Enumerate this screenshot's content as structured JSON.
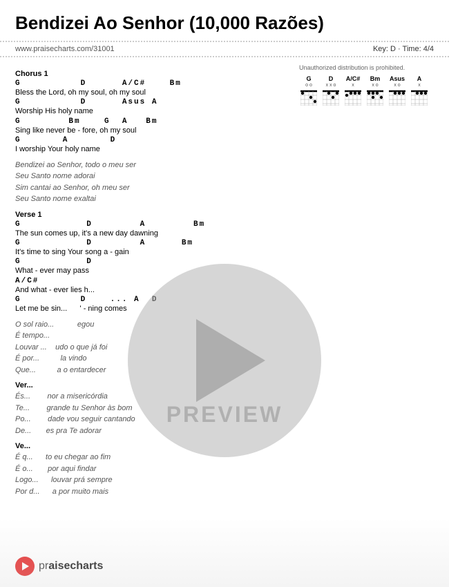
{
  "header": {
    "title": "Bendizei Ao Senhor (10,000 Razões)",
    "url": "www.praisecharts.com/31001",
    "key_time": "Key: D · Time: 4/4"
  },
  "unauthorized": "Unauthorized distribution is prohibited.",
  "chords": [
    {
      "name": "G",
      "indicators": "o o",
      "dots": []
    },
    {
      "name": "D",
      "indicators": "x x o",
      "dots": []
    },
    {
      "name": "A/C#",
      "indicators": "x",
      "dots": []
    },
    {
      "name": "Bm",
      "indicators": "x o",
      "dots": []
    },
    {
      "name": "Asus",
      "indicators": "x o",
      "dots": []
    },
    {
      "name": "A",
      "indicators": "x",
      "dots": []
    }
  ],
  "sections": [
    {
      "label": "Chorus 1",
      "stanzas": [
        {
          "lines": [
            {
              "type": "chord",
              "text": "G          D      A/C#    Bm"
            },
            {
              "type": "lyric",
              "text": "Bless the Lord, oh my soul,  oh  my soul"
            },
            {
              "type": "chord",
              "text": "G          D      Asus  A"
            },
            {
              "type": "lyric",
              "text": "Worship His holy name"
            },
            {
              "type": "chord",
              "text": "G        Bm    G  A   Bm"
            },
            {
              "type": "lyric",
              "text": "Sing like never be - fore, oh my soul"
            },
            {
              "type": "chord",
              "text": "G       A       D"
            },
            {
              "type": "lyric",
              "text": "I worship Your holy name"
            }
          ]
        },
        {
          "lines": [
            {
              "type": "lyric-italic",
              "text": "Bendizei ao Senhor, todo o meu ser"
            },
            {
              "type": "lyric-italic",
              "text": "Seu Santo nome adorai"
            },
            {
              "type": "lyric-italic",
              "text": "Sim cantai ao Senhor, oh meu ser"
            },
            {
              "type": "lyric-italic",
              "text": "Seu Santo nome exaltai"
            }
          ]
        }
      ]
    },
    {
      "label": "Verse 1",
      "stanzas": [
        {
          "lines": [
            {
              "type": "chord",
              "text": "G           D        A         Bm"
            },
            {
              "type": "lyric",
              "text": "The sun comes up, it's a new day dawning"
            },
            {
              "type": "chord",
              "text": "G           D        A      Bm"
            },
            {
              "type": "lyric",
              "text": "It's time to sing Your song a - gain"
            },
            {
              "type": "chord",
              "text": "G           D"
            },
            {
              "type": "lyric",
              "text": "What - ever may pass"
            },
            {
              "type": "chord",
              "text": "A/C#"
            },
            {
              "type": "lyric",
              "text": "And what - ever lies h..."
            },
            {
              "type": "chord",
              "text": "G          D    ... A  D"
            },
            {
              "type": "lyric",
              "text": "Let me be sin...      ' - ning comes"
            }
          ]
        },
        {
          "lines": [
            {
              "type": "lyric-italic",
              "text": "O sol raio...           egou"
            },
            {
              "type": "lyric-italic",
              "text": "É tempo..."
            },
            {
              "type": "lyric-italic",
              "text": "Louvar ...    udo o que já foi"
            },
            {
              "type": "lyric-italic",
              "text": "É por...          la vindo"
            },
            {
              "type": "lyric-italic",
              "text": "Que...          a o entardecer"
            }
          ]
        }
      ]
    },
    {
      "label": "Ver...",
      "stanzas": [
        {
          "lines": [
            {
              "type": "lyric-italic",
              "text": "És...        nor a misericórdia"
            },
            {
              "type": "lyric-italic",
              "text": "Te...        grande tu Senhor às bom"
            },
            {
              "type": "lyric-italic",
              "text": "Po...        dade vou seguir cantando"
            },
            {
              "type": "lyric-italic",
              "text": "De...       es pra Te adorar"
            }
          ]
        }
      ]
    },
    {
      "label": "Ve...",
      "stanzas": [
        {
          "lines": [
            {
              "type": "lyric-italic",
              "text": "É q...      to eu chegar ao fim"
            },
            {
              "type": "lyric-italic",
              "text": "É o...       por aqui findar"
            },
            {
              "type": "lyric-italic",
              "text": "Logo...      louvar prá sempre"
            },
            {
              "type": "lyric-italic",
              "text": "Por d...      a por muito mais"
            }
          ]
        }
      ]
    }
  ],
  "preview": {
    "label": "PREVIEW"
  },
  "footer": {
    "logo_label": "▶",
    "text_pre": "pr...",
    "text_bold": "charts"
  }
}
